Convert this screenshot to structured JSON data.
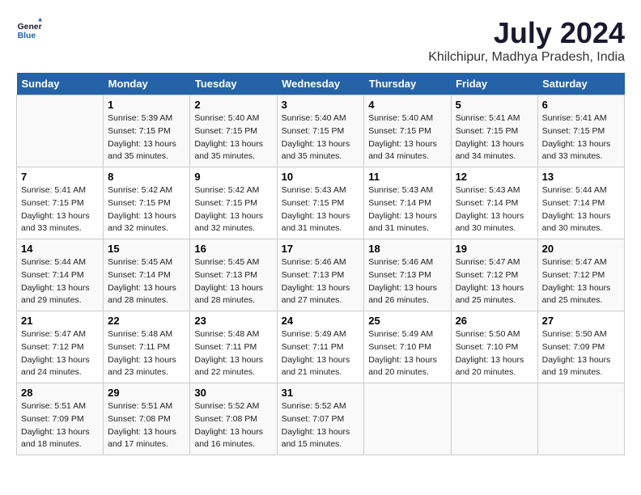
{
  "header": {
    "logo_line1": "General",
    "logo_line2": "Blue",
    "month_year": "July 2024",
    "location": "Khilchipur, Madhya Pradesh, India"
  },
  "weekdays": [
    "Sunday",
    "Monday",
    "Tuesday",
    "Wednesday",
    "Thursday",
    "Friday",
    "Saturday"
  ],
  "weeks": [
    [
      {
        "day": "",
        "info": ""
      },
      {
        "day": "1",
        "info": "Sunrise: 5:39 AM\nSunset: 7:15 PM\nDaylight: 13 hours\nand 35 minutes."
      },
      {
        "day": "2",
        "info": "Sunrise: 5:40 AM\nSunset: 7:15 PM\nDaylight: 13 hours\nand 35 minutes."
      },
      {
        "day": "3",
        "info": "Sunrise: 5:40 AM\nSunset: 7:15 PM\nDaylight: 13 hours\nand 35 minutes."
      },
      {
        "day": "4",
        "info": "Sunrise: 5:40 AM\nSunset: 7:15 PM\nDaylight: 13 hours\nand 34 minutes."
      },
      {
        "day": "5",
        "info": "Sunrise: 5:41 AM\nSunset: 7:15 PM\nDaylight: 13 hours\nand 34 minutes."
      },
      {
        "day": "6",
        "info": "Sunrise: 5:41 AM\nSunset: 7:15 PM\nDaylight: 13 hours\nand 33 minutes."
      }
    ],
    [
      {
        "day": "7",
        "info": "Sunrise: 5:41 AM\nSunset: 7:15 PM\nDaylight: 13 hours\nand 33 minutes."
      },
      {
        "day": "8",
        "info": "Sunrise: 5:42 AM\nSunset: 7:15 PM\nDaylight: 13 hours\nand 32 minutes."
      },
      {
        "day": "9",
        "info": "Sunrise: 5:42 AM\nSunset: 7:15 PM\nDaylight: 13 hours\nand 32 minutes."
      },
      {
        "day": "10",
        "info": "Sunrise: 5:43 AM\nSunset: 7:15 PM\nDaylight: 13 hours\nand 31 minutes."
      },
      {
        "day": "11",
        "info": "Sunrise: 5:43 AM\nSunset: 7:14 PM\nDaylight: 13 hours\nand 31 minutes."
      },
      {
        "day": "12",
        "info": "Sunrise: 5:43 AM\nSunset: 7:14 PM\nDaylight: 13 hours\nand 30 minutes."
      },
      {
        "day": "13",
        "info": "Sunrise: 5:44 AM\nSunset: 7:14 PM\nDaylight: 13 hours\nand 30 minutes."
      }
    ],
    [
      {
        "day": "14",
        "info": "Sunrise: 5:44 AM\nSunset: 7:14 PM\nDaylight: 13 hours\nand 29 minutes."
      },
      {
        "day": "15",
        "info": "Sunrise: 5:45 AM\nSunset: 7:14 PM\nDaylight: 13 hours\nand 28 minutes."
      },
      {
        "day": "16",
        "info": "Sunrise: 5:45 AM\nSunset: 7:13 PM\nDaylight: 13 hours\nand 28 minutes."
      },
      {
        "day": "17",
        "info": "Sunrise: 5:46 AM\nSunset: 7:13 PM\nDaylight: 13 hours\nand 27 minutes."
      },
      {
        "day": "18",
        "info": "Sunrise: 5:46 AM\nSunset: 7:13 PM\nDaylight: 13 hours\nand 26 minutes."
      },
      {
        "day": "19",
        "info": "Sunrise: 5:47 AM\nSunset: 7:12 PM\nDaylight: 13 hours\nand 25 minutes."
      },
      {
        "day": "20",
        "info": "Sunrise: 5:47 AM\nSunset: 7:12 PM\nDaylight: 13 hours\nand 25 minutes."
      }
    ],
    [
      {
        "day": "21",
        "info": "Sunrise: 5:47 AM\nSunset: 7:12 PM\nDaylight: 13 hours\nand 24 minutes."
      },
      {
        "day": "22",
        "info": "Sunrise: 5:48 AM\nSunset: 7:11 PM\nDaylight: 13 hours\nand 23 minutes."
      },
      {
        "day": "23",
        "info": "Sunrise: 5:48 AM\nSunset: 7:11 PM\nDaylight: 13 hours\nand 22 minutes."
      },
      {
        "day": "24",
        "info": "Sunrise: 5:49 AM\nSunset: 7:11 PM\nDaylight: 13 hours\nand 21 minutes."
      },
      {
        "day": "25",
        "info": "Sunrise: 5:49 AM\nSunset: 7:10 PM\nDaylight: 13 hours\nand 20 minutes."
      },
      {
        "day": "26",
        "info": "Sunrise: 5:50 AM\nSunset: 7:10 PM\nDaylight: 13 hours\nand 20 minutes."
      },
      {
        "day": "27",
        "info": "Sunrise: 5:50 AM\nSunset: 7:09 PM\nDaylight: 13 hours\nand 19 minutes."
      }
    ],
    [
      {
        "day": "28",
        "info": "Sunrise: 5:51 AM\nSunset: 7:09 PM\nDaylight: 13 hours\nand 18 minutes."
      },
      {
        "day": "29",
        "info": "Sunrise: 5:51 AM\nSunset: 7:08 PM\nDaylight: 13 hours\nand 17 minutes."
      },
      {
        "day": "30",
        "info": "Sunrise: 5:52 AM\nSunset: 7:08 PM\nDaylight: 13 hours\nand 16 minutes."
      },
      {
        "day": "31",
        "info": "Sunrise: 5:52 AM\nSunset: 7:07 PM\nDaylight: 13 hours\nand 15 minutes."
      },
      {
        "day": "",
        "info": ""
      },
      {
        "day": "",
        "info": ""
      },
      {
        "day": "",
        "info": ""
      }
    ]
  ]
}
